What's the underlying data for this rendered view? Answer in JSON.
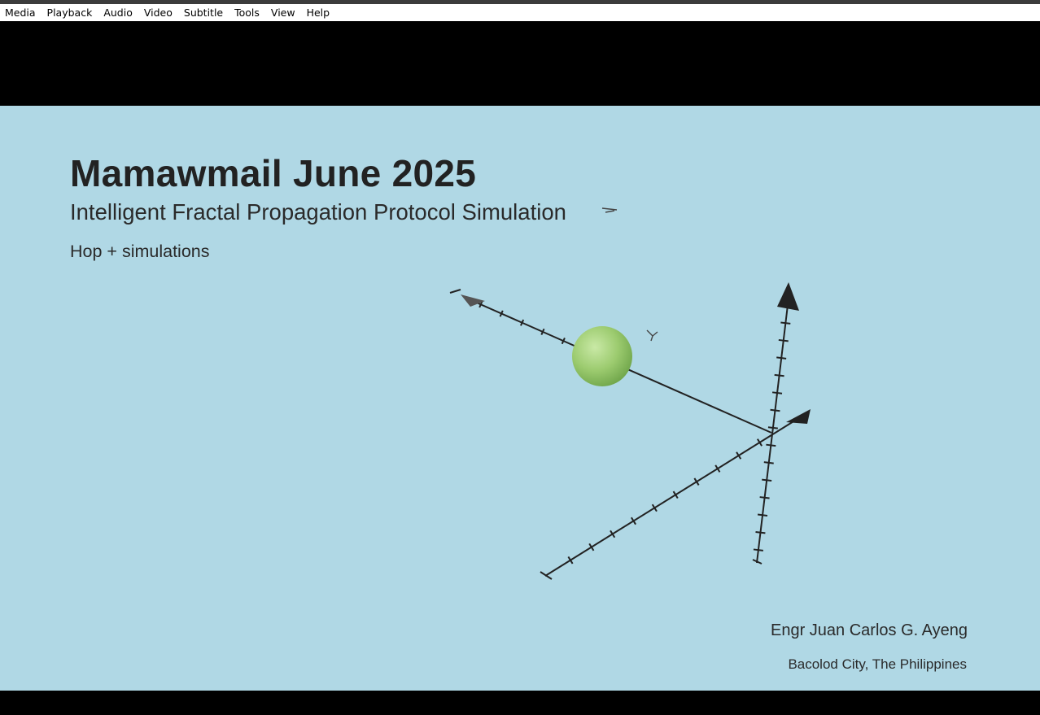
{
  "menu": {
    "items": [
      "Media",
      "Playback",
      "Audio",
      "Video",
      "Subtitle",
      "Tools",
      "View",
      "Help"
    ]
  },
  "slide": {
    "title": "Mamawmail June 2025",
    "subtitle": "Intelligent Fractal Propagation Protocol Simulation",
    "tagline": "Hop + simulations",
    "author": "Engr Juan Carlos G. Ayeng",
    "location": "Bacolod City, The Philippines",
    "background_color": "#b0d8e5",
    "sphere_color": "#93c46a"
  }
}
